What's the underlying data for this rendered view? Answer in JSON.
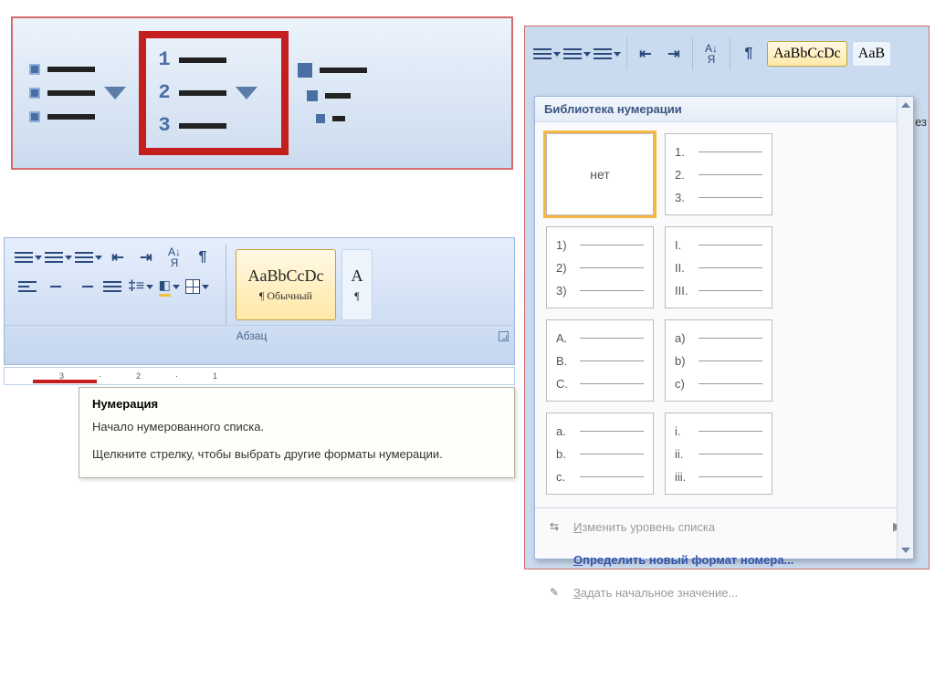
{
  "top": {
    "nums": [
      "1",
      "2",
      "3"
    ]
  },
  "mid": {
    "group_label": "Абзац",
    "style": {
      "sample": "AaBbCcDc",
      "label": "¶ Обычный"
    }
  },
  "ruler": [
    "3",
    "2",
    "1"
  ],
  "tooltip": {
    "title": "Нумерация",
    "line1": "Начало нумерованного списка.",
    "line2": "Щелкните стрелку, чтобы выбрать другие форматы нумерации."
  },
  "right": {
    "style_sample": "AaBbCcDc",
    "style_cut": "AaB",
    "corner_text": "ез"
  },
  "gallery": {
    "header": "Библиотека нумерации",
    "none_label": "нет",
    "opts": [
      [
        "1.",
        "2.",
        "3."
      ],
      [
        "1)",
        "2)",
        "3)"
      ],
      [
        "I.",
        "II.",
        "III."
      ],
      [
        "A.",
        "B.",
        "C."
      ],
      [
        "a)",
        "b)",
        "c)"
      ],
      [
        "a.",
        "b.",
        "c."
      ],
      [
        "i.",
        "ii.",
        "iii."
      ]
    ],
    "cmd_level": "Изменить уровень списка",
    "cmd_define": "Определить новый формат номера...",
    "cmd_setstart": "Задать начальное значение..."
  }
}
